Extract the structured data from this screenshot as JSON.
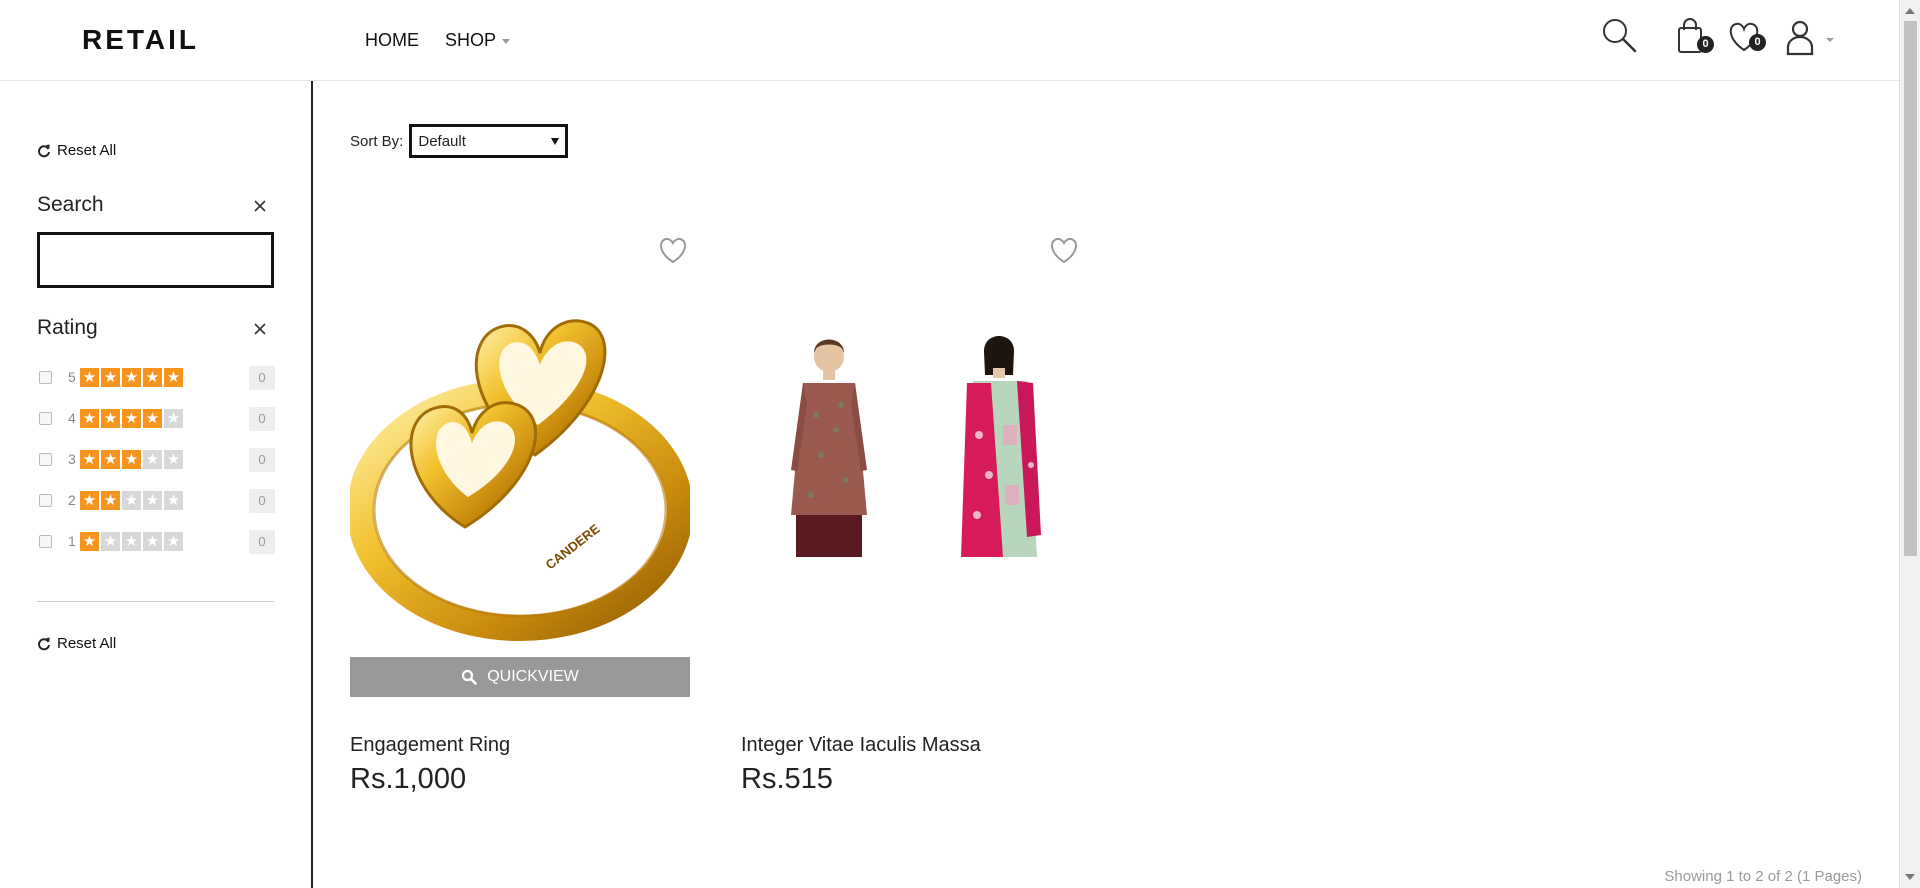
{
  "header": {
    "logo": "RETAIL",
    "nav": [
      {
        "label": "HOME"
      },
      {
        "label": "SHOP"
      }
    ],
    "cart_count": "0",
    "wishlist_count": "0"
  },
  "sidebar": {
    "reset_top": "Reset All",
    "search_title": "Search",
    "search_value": "",
    "rating_title": "Rating",
    "ratings": [
      {
        "stars": "5",
        "filled": 5,
        "count": "0"
      },
      {
        "stars": "4",
        "filled": 4,
        "count": "0"
      },
      {
        "stars": "3",
        "filled": 3,
        "count": "0"
      },
      {
        "stars": "2",
        "filled": 2,
        "count": "0"
      },
      {
        "stars": "1",
        "filled": 1,
        "count": "0"
      }
    ],
    "reset_bottom": "Reset All"
  },
  "main": {
    "sort_label": "Sort By:",
    "sort_value": "Default",
    "products": [
      {
        "name": "Engagement Ring",
        "price": "Rs.1,000",
        "quickview": "QUICKVIEW",
        "engraving": "CANDERE"
      },
      {
        "name": "Integer Vitae Iaculis Massa",
        "price": "Rs.515"
      }
    ],
    "showing": "Showing 1 to 2 of 2 (1 Pages)"
  },
  "colors": {
    "star_on": "#f7941d",
    "star_off": "#d8d8d8",
    "quickview_bg": "#999999",
    "ring_gold": "#e2a81b"
  }
}
